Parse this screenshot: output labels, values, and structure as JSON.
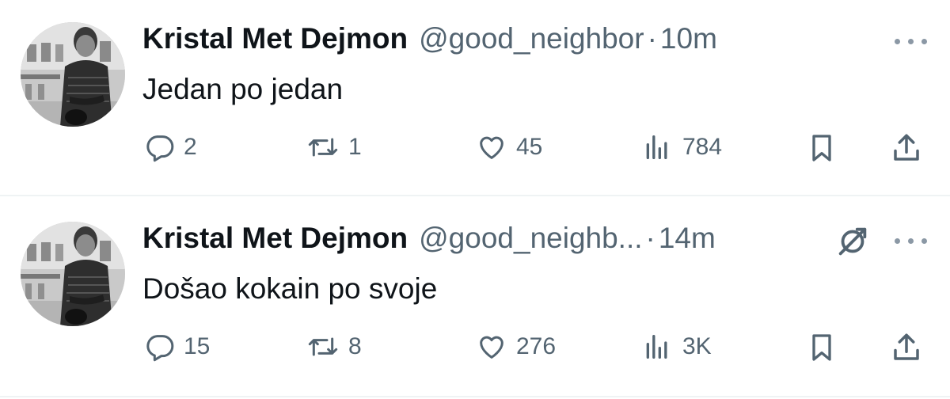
{
  "tweets": [
    {
      "name": "Kristal Met Dejmon",
      "handle": "@good_neighbor",
      "separator": "·",
      "time": "10m",
      "text": "Jedan po jedan",
      "replies": "2",
      "retweets": "1",
      "likes": "45",
      "views": "784",
      "pinned_icon": false
    },
    {
      "name": "Kristal Met Dejmon",
      "handle": "@good_neighb...",
      "separator": "·",
      "time": "14m",
      "text": "Došao kokain po svoje",
      "replies": "15",
      "retweets": "8",
      "likes": "276",
      "views": "3K",
      "pinned_icon": true
    }
  ],
  "icons": {
    "reply": "reply-icon",
    "retweet": "retweet-icon",
    "like": "heart-icon",
    "views": "views-icon",
    "bookmark": "bookmark-icon",
    "share": "share-icon",
    "more": "more-dots-icon",
    "pin": "pin-icon"
  },
  "colors": {
    "text_primary": "#0f1419",
    "text_secondary": "#536471",
    "divider": "#eff3f4"
  }
}
